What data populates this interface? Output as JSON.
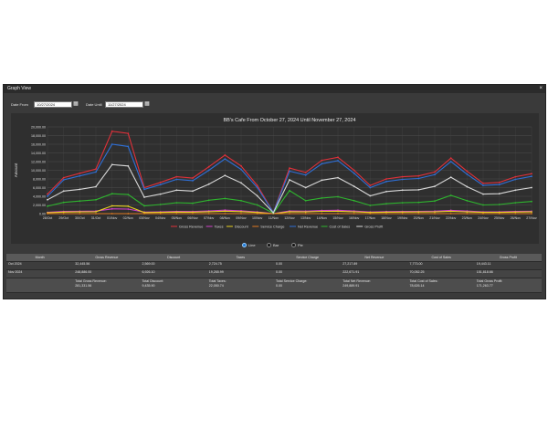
{
  "window": {
    "title": "Graph View",
    "close": "×"
  },
  "filters": {
    "date_from_label": "Date From",
    "date_from_value": "10/27/2024",
    "date_until_label": "Date Until",
    "date_until_value": "11/27/2024"
  },
  "view_options": [
    {
      "label": "Line",
      "selected": true
    },
    {
      "label": "Bar",
      "selected": false
    },
    {
      "label": "Pie",
      "selected": false
    }
  ],
  "chart_data": {
    "type": "line",
    "title": "BB's Cafe From October 27, 2024 Until November 27, 2024",
    "ylabel": "Amount",
    "xlabel": "",
    "ylim": [
      0,
      20000
    ],
    "y_ticks": [
      "0.00",
      "2,000.00",
      "4,000.00",
      "6,000.00",
      "8,000.00",
      "10,000.00",
      "12,000.00",
      "14,000.00",
      "16,000.00",
      "18,000.00",
      "20,000.00"
    ],
    "categories": [
      "28/Oct",
      "29/Oct",
      "30/Oct",
      "31/Oct",
      "01/Nov",
      "02/Nov",
      "03/Nov",
      "04/Nov",
      "05/Nov",
      "06/Nov",
      "07/Nov",
      "08/Nov",
      "09/Nov",
      "10/Nov",
      "11/Nov",
      "12/Nov",
      "13/Nov",
      "14/Nov",
      "15/Nov",
      "16/Nov",
      "17/Nov",
      "18/Nov",
      "19/Nov",
      "20/Nov",
      "21/Nov",
      "22/Nov",
      "23/Nov",
      "24/Nov",
      "25/Nov",
      "26/Nov",
      "27/Nov"
    ],
    "grid": true,
    "legend": "bottom",
    "series": [
      {
        "name": "Gross Revenue",
        "color": "#e0303a",
        "values": [
          4500,
          8300,
          9300,
          10300,
          19000,
          18500,
          6000,
          7200,
          8500,
          8200,
          10800,
          13500,
          11000,
          6500,
          300,
          10500,
          9500,
          12300,
          13000,
          10000,
          6500,
          8000,
          8500,
          8700,
          9600,
          12800,
          9800,
          7000,
          7200,
          8500,
          9200
        ]
      },
      {
        "name": "Taxes",
        "color": "#d040c8",
        "values": [
          300,
          500,
          550,
          600,
          1100,
          1050,
          350,
          420,
          500,
          480,
          640,
          800,
          650,
          380,
          20,
          620,
          560,
          730,
          770,
          590,
          380,
          470,
          500,
          510,
          560,
          750,
          580,
          410,
          420,
          500,
          540
        ]
      },
      {
        "name": "Discount",
        "color": "#e8d020",
        "values": [
          200,
          350,
          400,
          450,
          1800,
          1700,
          250,
          300,
          350,
          340,
          450,
          560,
          460,
          270,
          10,
          450,
          400,
          520,
          550,
          420,
          270,
          340,
          360,
          370,
          400,
          540,
          410,
          290,
          300,
          360,
          390
        ]
      },
      {
        "name": "Service Charge",
        "color": "#e07a20",
        "values": [
          0,
          0,
          0,
          0,
          0,
          0,
          0,
          0,
          0,
          0,
          0,
          0,
          0,
          0,
          0,
          0,
          0,
          0,
          0,
          0,
          0,
          0,
          0,
          0,
          0,
          0,
          0,
          0,
          0,
          0,
          0
        ]
      },
      {
        "name": "Net Revenue",
        "color": "#2f6fd6",
        "values": [
          4000,
          7800,
          8700,
          9600,
          16000,
          15500,
          5600,
          6700,
          7900,
          7600,
          10000,
          12600,
          10200,
          6000,
          280,
          9800,
          8900,
          11500,
          12200,
          9300,
          6000,
          7400,
          7900,
          8100,
          9000,
          12000,
          9100,
          6500,
          6700,
          7900,
          8600
        ]
      },
      {
        "name": "Cost of Sales",
        "color": "#2fb42f",
        "values": [
          1700,
          2600,
          2900,
          3200,
          4600,
          4400,
          1800,
          2100,
          2500,
          2400,
          3100,
          3500,
          3000,
          2000,
          100,
          5300,
          3000,
          3600,
          3900,
          3000,
          1900,
          2300,
          2500,
          2600,
          2900,
          4200,
          3000,
          2000,
          2100,
          2500,
          2800
        ]
      },
      {
        "name": "Gross Profit",
        "color": "#d8d8d8",
        "values": [
          3200,
          5200,
          5600,
          6200,
          11300,
          11000,
          3800,
          4500,
          5400,
          5200,
          6800,
          8800,
          7100,
          4100,
          180,
          7800,
          6000,
          7700,
          8300,
          6300,
          4100,
          5100,
          5400,
          5500,
          6300,
          8400,
          6200,
          4500,
          4600,
          5400,
          6000
        ]
      }
    ]
  },
  "summary_table": {
    "headers": [
      "Month",
      "Gross Revenue",
      "Discount",
      "Taxes",
      "Service Charge",
      "Net Revenue",
      "Cost of Sales",
      "Gross Profit"
    ],
    "rows": [
      [
        "Oct 2024",
        "32,445.56",
        "2,569.00",
        "2,724.75",
        "0.00",
        "27,217.89",
        "7,773.00",
        "19,443.11"
      ],
      [
        "Nov 2024",
        "248,886.00",
        "6,926.10",
        "19,265.99",
        "0.00",
        "222,671.91",
        "70,052.25",
        "151,818.66"
      ]
    ],
    "totals": [
      {
        "label": "",
        "value": ""
      },
      {
        "label": "Total Gross Revenue:",
        "value": "281,331.56"
      },
      {
        "label": "Total Discount:",
        "value": "9,435.90"
      },
      {
        "label": "Total Taxes:",
        "value": "22,050.74"
      },
      {
        "label": "Total Service Charge:",
        "value": "0.00"
      },
      {
        "label": "Total Net Revenue:",
        "value": "249,889.91"
      },
      {
        "label": "Total Cost of Sales:",
        "value": "78,626.14"
      },
      {
        "label": "Total Gross Profit:",
        "value": "171,263.77"
      }
    ]
  }
}
